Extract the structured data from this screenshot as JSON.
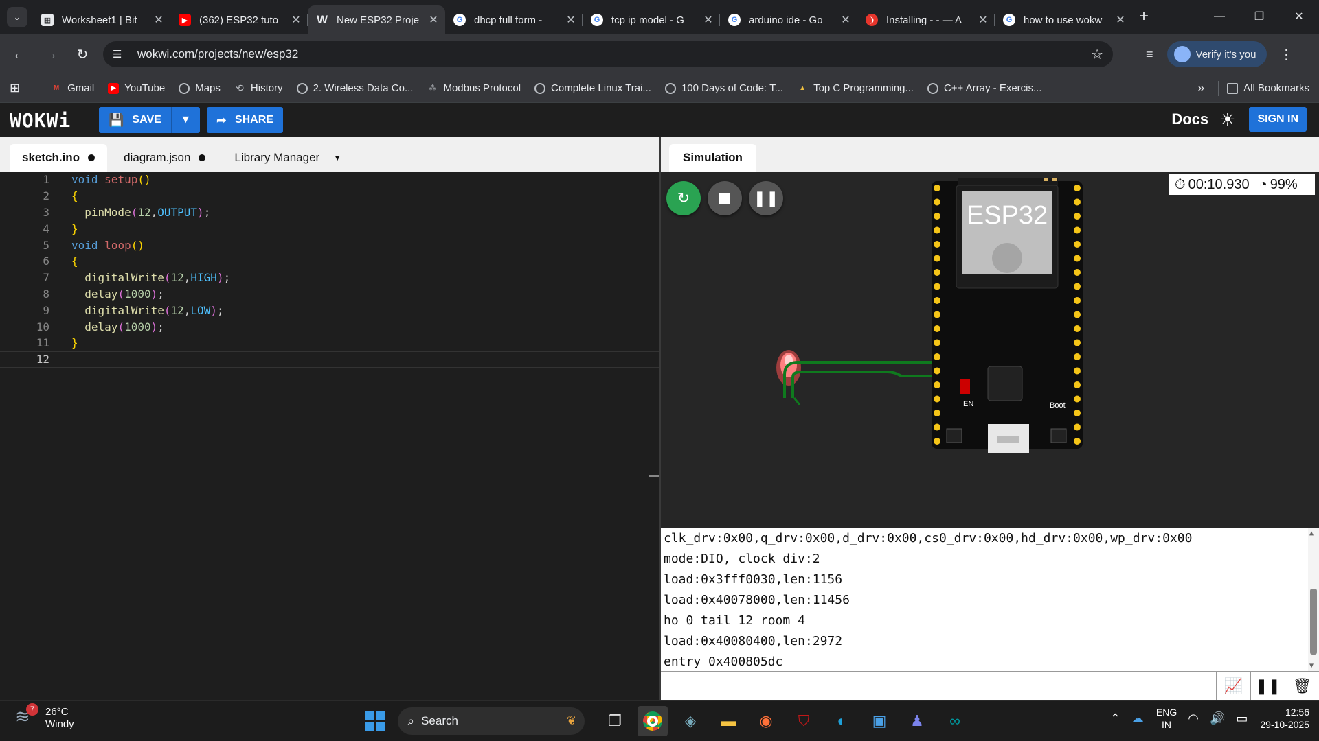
{
  "browser": {
    "tabs": [
      {
        "title": "Worksheet1 | Bit",
        "icon": "sheet-favicon-icon",
        "color": "#e8eaed"
      },
      {
        "title": "(362) ESP32 tuto",
        "icon": "youtube-icon",
        "color": "#ff0000"
      },
      {
        "title": "New ESP32 Proje",
        "icon": "wokwi-icon",
        "color": "#e8eaed",
        "active": true
      },
      {
        "title": "dhcp full form -",
        "icon": "google-icon",
        "color": "#ffffff"
      },
      {
        "title": "tcp ip model - G",
        "icon": "google-icon",
        "color": "#ffffff"
      },
      {
        "title": "arduino ide - Go",
        "icon": "google-icon",
        "color": "#ffffff"
      },
      {
        "title": "Installing - - — A",
        "icon": "espressif-icon",
        "color": "#e7352c"
      },
      {
        "title": "how to use wokw",
        "icon": "google-icon",
        "color": "#ffffff"
      }
    ],
    "url": "wokwi.com/projects/new/esp32",
    "verify_label": "Verify it's you",
    "bookmarks": [
      "Gmail",
      "YouTube",
      "Maps",
      "History",
      "2. Wireless Data Co...",
      "Modbus Protocol",
      "Complete Linux Trai...",
      "100 Days of Code: T...",
      "Top C Programming...",
      "C++ Array - Exercis..."
    ],
    "all_bookmarks": "All Bookmarks"
  },
  "wokwi": {
    "logo": "WOKWi",
    "save_label": "SAVE",
    "share_label": "SHARE",
    "docs_label": "Docs",
    "signin_label": "SIGN IN",
    "editor_tabs": [
      "sketch.ino",
      "diagram.json",
      "Library Manager"
    ],
    "simulation_tab": "Simulation",
    "timer": "00:10.930",
    "speed": "99%",
    "board_label": "ESP32",
    "board_en": "EN",
    "board_boot": "Boot"
  },
  "code_lines": [
    "void setup()",
    "{",
    "  pinMode(12,OUTPUT);",
    "}",
    "void loop()",
    "{",
    "  digitalWrite(12,HIGH);",
    "  delay(1000);",
    "  digitalWrite(12,LOW);",
    "  delay(1000);",
    "}",
    ""
  ],
  "serial_lines": [
    "clk_drv:0x00,q_drv:0x00,d_drv:0x00,cs0_drv:0x00,hd_drv:0x00,wp_drv:0x00",
    "mode:DIO, clock div:2",
    "load:0x3fff0030,len:1156",
    "load:0x40078000,len:11456",
    "ho 0 tail 12 room 4",
    "load:0x40080400,len:2972",
    "entry 0x400805dc"
  ],
  "taskbar": {
    "temperature": "26°C",
    "weather": "Windy",
    "weather_badge": "7",
    "search_label": "Search",
    "lang1": "ENG",
    "lang2": "IN",
    "time": "12:56",
    "date": "29-10-2025"
  }
}
